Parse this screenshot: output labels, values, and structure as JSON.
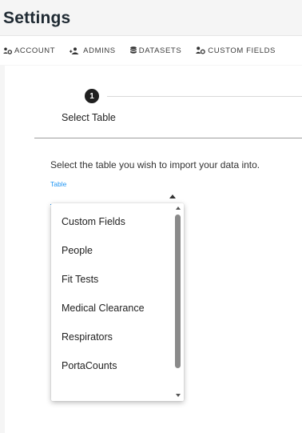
{
  "page": {
    "title": "Settings"
  },
  "tabs": [
    {
      "label": "ACCOUNT",
      "icon": "account-cog-icon"
    },
    {
      "label": "ADMINS",
      "icon": "admins-icon"
    },
    {
      "label": "DATASETS",
      "icon": "database-icon"
    },
    {
      "label": "CUSTOM FIELDS",
      "icon": "custom-fields-icon"
    }
  ],
  "stepper": {
    "steps": [
      {
        "number": "1",
        "label": "Select Table"
      }
    ]
  },
  "import": {
    "instruction": "Select the table you wish to import your data into.",
    "select_label": "Table",
    "options": [
      "Custom Fields",
      "People",
      "Fit Tests",
      "Medical Clearance",
      "Respirators",
      "PortaCounts"
    ]
  },
  "colors": {
    "accent": "#2196f3",
    "step_active": "#1f1f1f",
    "background": "#f5f5f5"
  }
}
